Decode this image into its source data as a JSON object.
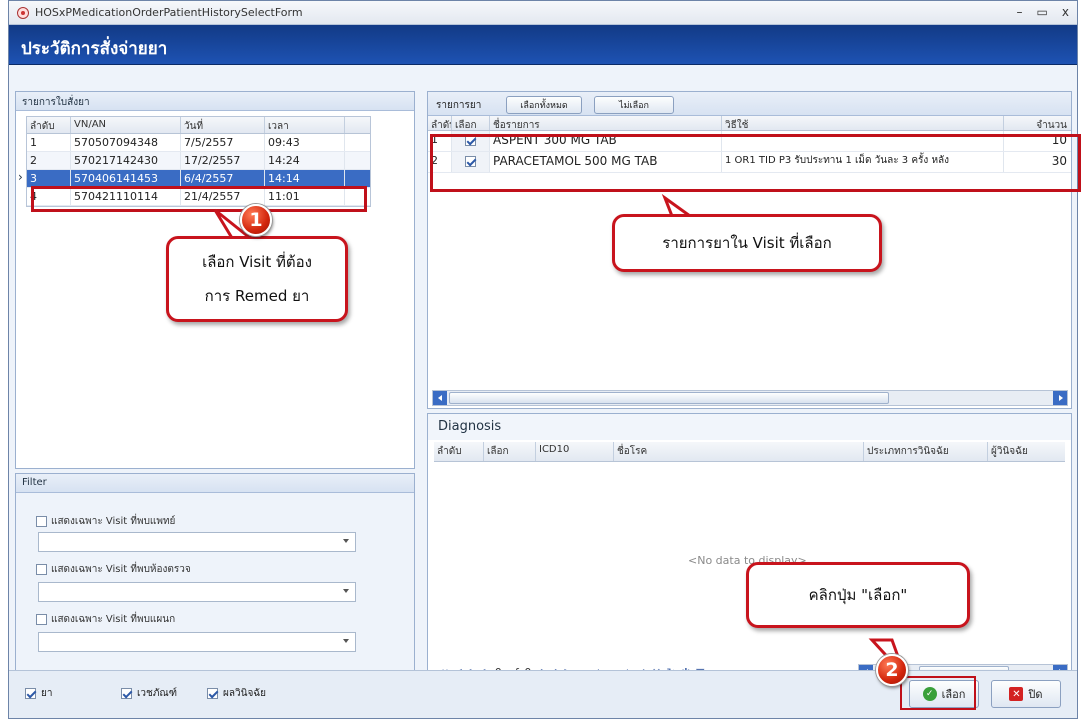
{
  "window": {
    "title": "HOSxPMedicationOrderPatientHistorySelectForm",
    "min": "–",
    "max": "▭",
    "close": "x"
  },
  "header": {
    "title": "ประวัติการสั่งจ่ายยา"
  },
  "orders_panel": {
    "title": "รายการใบสั่งยา",
    "columns": [
      "ลำดับ",
      "VN/AN",
      "วันที่",
      "เวลา"
    ],
    "rows": [
      [
        "1",
        "570507094348",
        "7/5/2557",
        "09:43"
      ],
      [
        "2",
        "570217142430",
        "17/2/2557",
        "14:24"
      ],
      [
        "3",
        "570406141453",
        "6/4/2557",
        "14:14"
      ],
      [
        "4",
        "570421110114",
        "21/4/2557",
        "11:01"
      ]
    ],
    "selected_row_index": 2,
    "row_indicator": "›"
  },
  "filter": {
    "title": "Filter",
    "options": [
      {
        "label": "แสดงเฉพาะ Visit ที่พบแพทย์"
      },
      {
        "label": "แสดงเฉพาะ Visit ที่พบห้องตรวจ"
      },
      {
        "label": "แสดงเฉพาะ Visit ที่พบแผนก"
      }
    ]
  },
  "drugs_panel": {
    "tab_label": "รายการยา",
    "select_all_label": "เลือกทั้งหมด",
    "deselect_label": "ไม่เลือก",
    "columns": [
      "ลำดับ",
      "เลือก",
      "ชื่อรายการ",
      "วิธีใช้",
      "จำนวน"
    ],
    "rows": [
      {
        "no": "1",
        "checked": true,
        "name": "ASPENT 300 MG TAB",
        "usage": "",
        "qty": "10"
      },
      {
        "no": "2",
        "checked": true,
        "name": "PARACETAMOL 500 MG TAB",
        "usage": "1 OR1 TID P3 รับประทาน 1 เม็ด วันละ 3 ครั้ง หลัง",
        "qty": "30"
      }
    ]
  },
  "diagnosis": {
    "title": "Diagnosis",
    "columns": [
      "ลำดับ",
      "เลือก",
      "ICD10",
      "ชื่อโรค",
      "ประเภทการวินิจฉัย",
      "ผู้วินิจฉัย"
    ],
    "empty_text": "<No data to display>",
    "pager_text": "0 of 0"
  },
  "bottom": {
    "checks": [
      {
        "label": "ยา",
        "checked": true
      },
      {
        "label": "เวชภัณฑ์",
        "checked": true
      },
      {
        "label": "ผลวินิจฉัย",
        "checked": true
      }
    ],
    "select_button": "เลือก",
    "close_button": "ปิด"
  },
  "callouts": {
    "step1_badge": "1",
    "step1_text_line1": "เลือก Visit ที่ต้อง",
    "step1_text_line2": "การ Remed ยา",
    "drugs_note": "รายการยาใน Visit ที่เลือก",
    "step2_badge": "2",
    "step2_text": "คลิกปุ่ม \"เลือก\""
  },
  "colors": {
    "header": "#1a4aa6",
    "selection": "#3a6cc4",
    "callout_border": "#c8141d"
  }
}
